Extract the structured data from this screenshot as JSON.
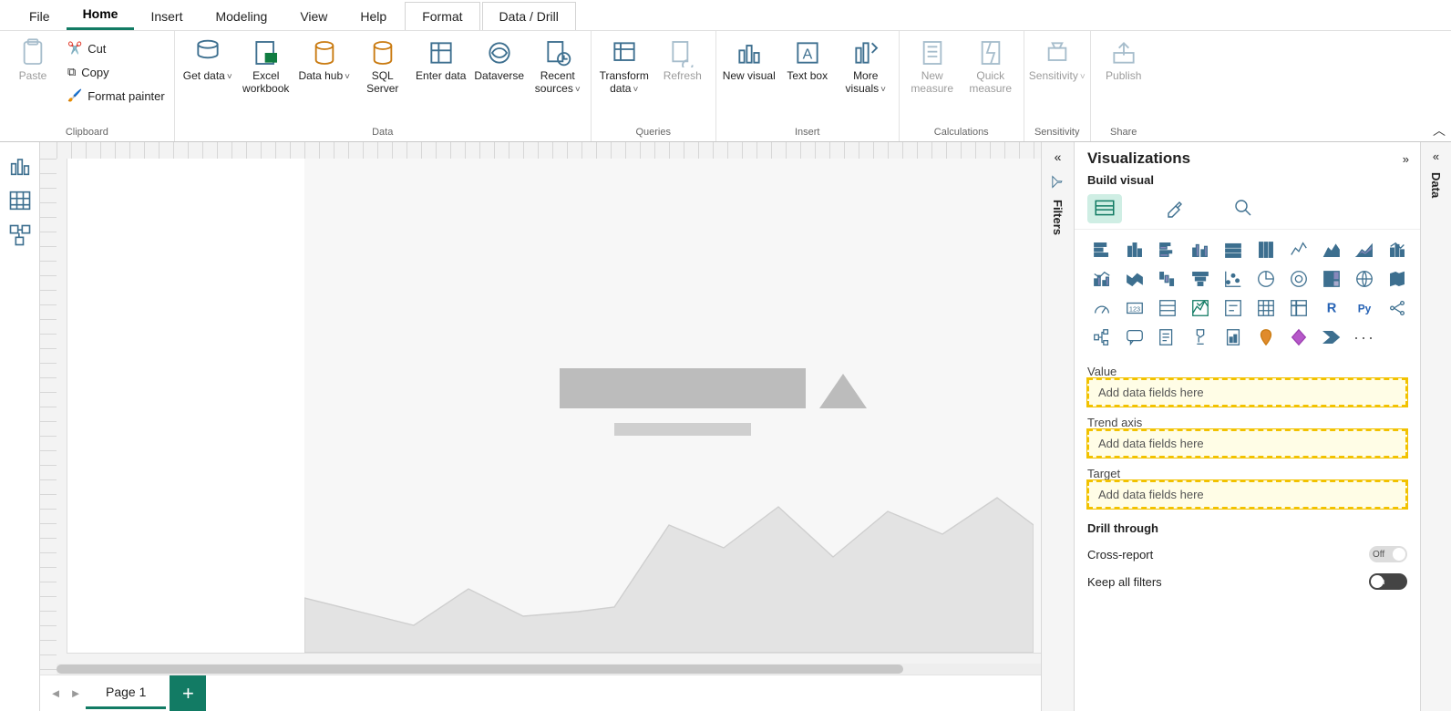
{
  "ribbon": {
    "tabs": [
      "File",
      "Home",
      "Insert",
      "Modeling",
      "View",
      "Help",
      "Format",
      "Data / Drill"
    ],
    "active_tab": "Home",
    "context_tabs": [
      "Format",
      "Data / Drill"
    ],
    "clipboard": {
      "paste": "Paste",
      "cut": "Cut",
      "copy": "Copy",
      "format_painter": "Format painter",
      "group": "Clipboard"
    },
    "data": {
      "get_data": "Get data",
      "excel": "Excel workbook",
      "data_hub": "Data hub",
      "sql": "SQL Server",
      "enter": "Enter data",
      "dataverse": "Dataverse",
      "recent": "Recent sources",
      "group": "Data"
    },
    "queries": {
      "transform": "Transform data",
      "refresh": "Refresh",
      "group": "Queries"
    },
    "insert": {
      "new_visual": "New visual",
      "text_box": "Text box",
      "more_visuals": "More visuals",
      "group": "Insert"
    },
    "calculations": {
      "new_measure": "New measure",
      "quick_measure": "Quick measure",
      "group": "Calculations"
    },
    "sensitivity": {
      "label": "Sensitivity",
      "group": "Sensitivity"
    },
    "share": {
      "publish": "Publish",
      "group": "Share"
    }
  },
  "left_rail": {
    "report": "Report view",
    "data": "Data view",
    "model": "Model view"
  },
  "pages": {
    "page1": "Page 1",
    "add": "+"
  },
  "filters": {
    "title": "Filters"
  },
  "viz": {
    "title": "Visualizations",
    "subtitle": "Build visual",
    "wells": {
      "value": {
        "label": "Value",
        "placeholder": "Add data fields here"
      },
      "trend": {
        "label": "Trend axis",
        "placeholder": "Add data fields here"
      },
      "target": {
        "label": "Target",
        "placeholder": "Add data fields here"
      }
    },
    "drill": {
      "title": "Drill through",
      "cross": "Cross-report",
      "keep": "Keep all filters",
      "off": "Off",
      "on": "On"
    }
  },
  "data_panel": {
    "title": "Data"
  }
}
